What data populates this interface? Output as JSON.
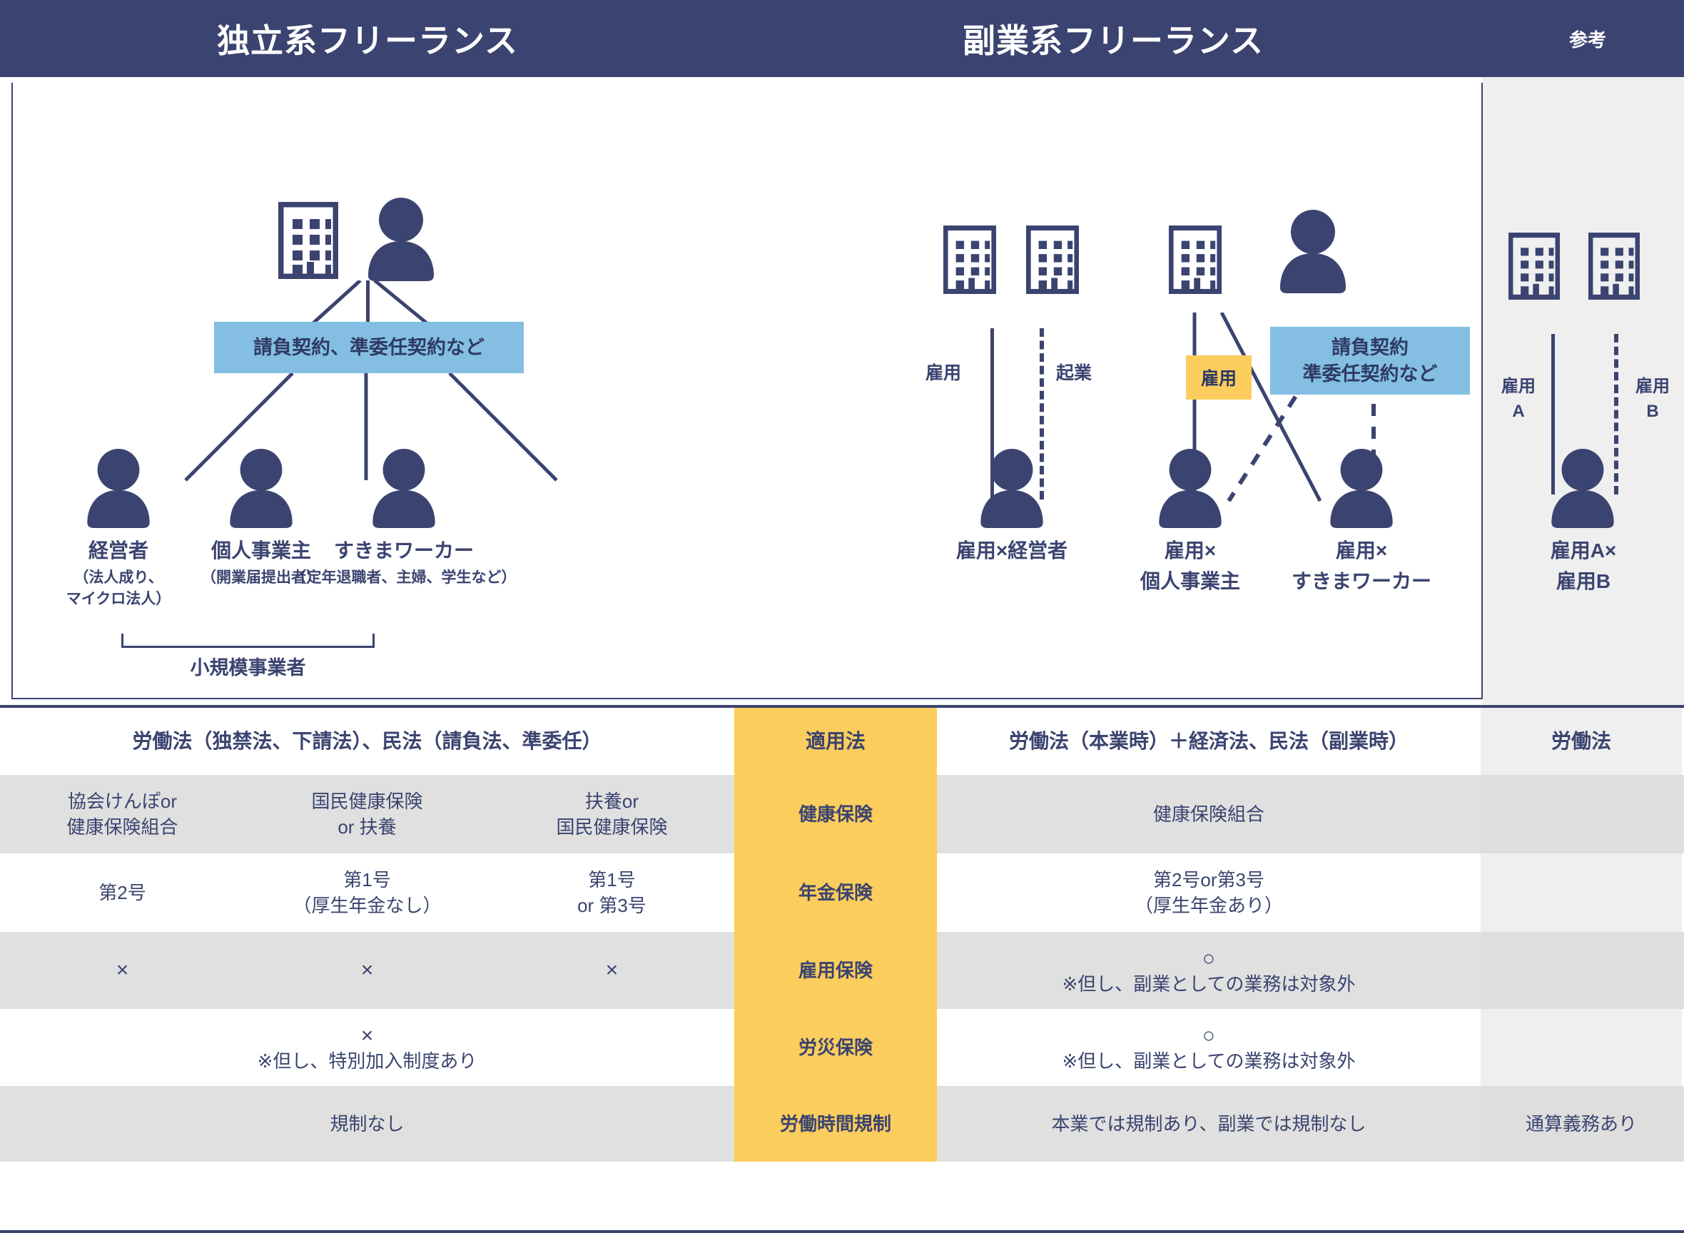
{
  "header": {
    "left_title": "独立系フリーランス",
    "mid_title": "副業系フリーランス",
    "right_title": "参考"
  },
  "diagram": {
    "left": {
      "contract_label": "請負契約、準委任契約など",
      "persons": [
        {
          "name": "経営者",
          "sub1": "（法人成り、",
          "sub2": "マイクロ法人）"
        },
        {
          "name": "個人事業主",
          "sub1": "（開業届提出者）",
          "sub2": ""
        },
        {
          "name": "すきまワーカー",
          "sub1": "（定年退職者、主婦、学生など）",
          "sub2": ""
        }
      ],
      "bracket_label": "小規模事業者"
    },
    "mid": {
      "link_employ": "雇用",
      "link_startup": "起業",
      "employ_chip": "雇用",
      "contract_line1": "請負契約",
      "contract_line2": "準委任契約など",
      "persons": [
        {
          "line1": "雇用×経営者",
          "line2": ""
        },
        {
          "line1": "雇用×",
          "line2": "個人事業主"
        },
        {
          "line1": "雇用×",
          "line2": "すきまワーカー"
        }
      ]
    },
    "ref": {
      "label_a_l1": "雇用",
      "label_a_l2": "A",
      "label_b_l1": "雇用",
      "label_b_l2": "B",
      "person_l1": "雇用A×",
      "person_l2": "雇用B"
    }
  },
  "table": {
    "header": {
      "left_span": "労働法（独禁法、下請法）、民法（請負法、準委任）",
      "mid": "適用法",
      "sub": "労働法（本業時）＋経済法、民法（副業時）",
      "ref": "労働法"
    },
    "rows": [
      {
        "mid": "健康保険",
        "c1": "協会けんぽor\n健康保険組合",
        "c2": "国民健康保険\nor 扶養",
        "c3": "扶養or\n国民健康保険",
        "sub": "健康保険組合",
        "ref": ""
      },
      {
        "mid": "年金保険",
        "c1": "第2号",
        "c2": "第1号\n（厚生年金なし）",
        "c3": "第1号\nor 第3号",
        "sub": "第2号or第3号\n（厚生年金あり）",
        "ref": ""
      },
      {
        "mid": "雇用保険",
        "c1": "×",
        "c2": "×",
        "c3": "×",
        "sub_big": "○",
        "sub_small": "※但し、副業としての業務は対象外",
        "ref": ""
      },
      {
        "mid": "労災保険",
        "span_big": "×",
        "span_small": "※但し、特別加入制度あり",
        "sub_big": "○",
        "sub_small": "※但し、副業としての業務は対象外",
        "ref": ""
      },
      {
        "mid": "労働時間規制",
        "span": "規制なし",
        "sub": "本業では規制あり、副業では規制なし",
        "ref": "通算義務あり"
      }
    ]
  },
  "colors": {
    "navy": "#3b4470",
    "light_blue": "#84bfe3",
    "yellow": "#fbcd5c",
    "gray_row": "#e0e0e0",
    "ref_gray": "#efefef"
  }
}
